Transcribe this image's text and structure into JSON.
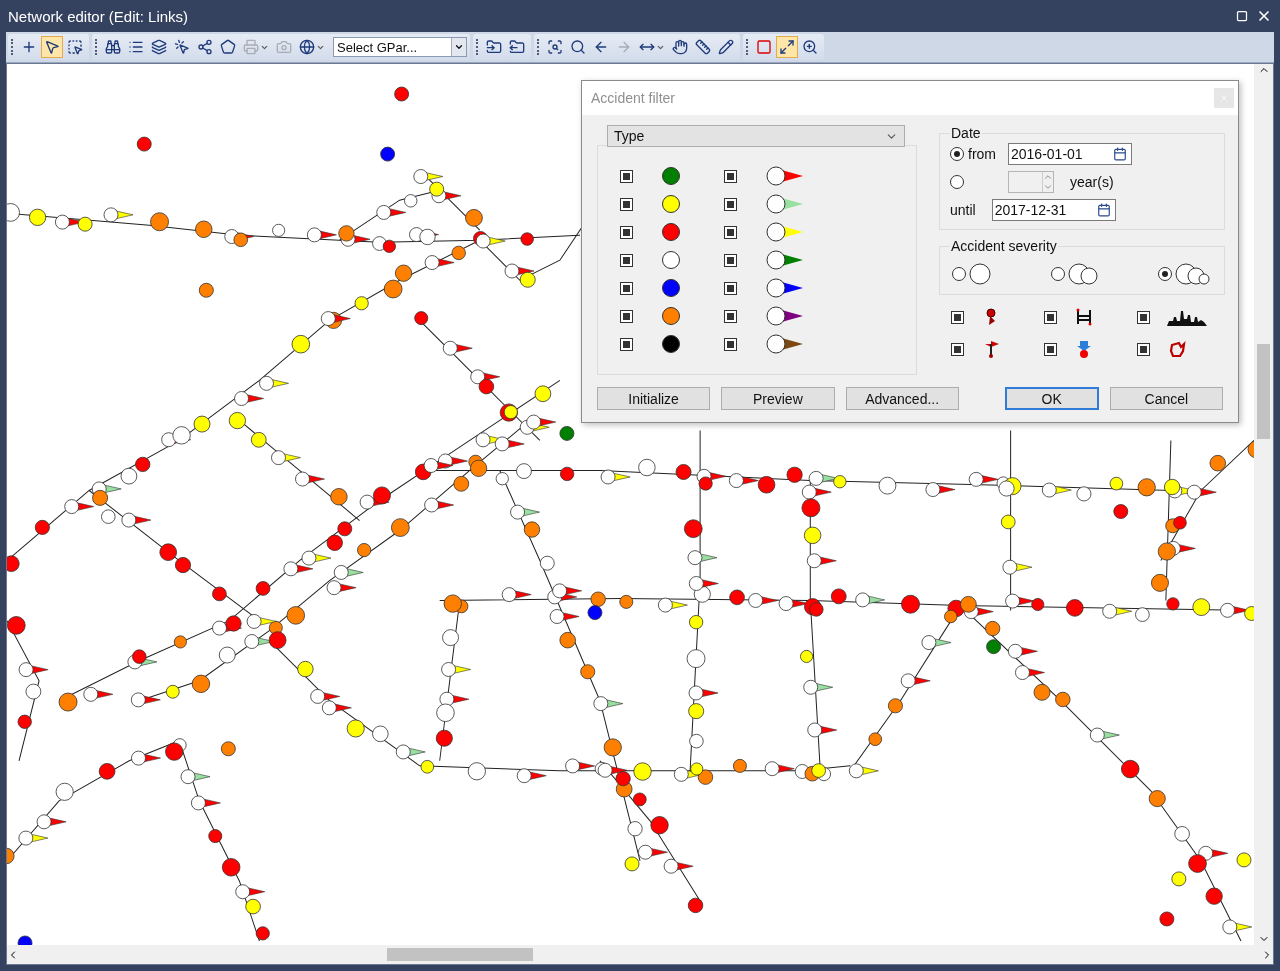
{
  "window": {
    "title": "Network editor (Edit: Links)"
  },
  "toolbar": {
    "groups": [
      [
        {
          "kind": "button",
          "selected": false,
          "disabled": false
        },
        {
          "kind": "button",
          "selected": true,
          "disabled": false
        },
        {
          "kind": "button",
          "selected": false,
          "disabled": false
        }
      ],
      [
        {
          "kind": "button",
          "selected": false,
          "disabled": false
        },
        {
          "kind": "button",
          "selected": false,
          "disabled": false
        },
        {
          "kind": "button",
          "selected": false,
          "disabled": false
        },
        {
          "kind": "button",
          "selected": false,
          "disabled": false
        },
        {
          "kind": "button",
          "selected": false,
          "disabled": false
        },
        {
          "kind": "button",
          "selected": false,
          "disabled": false
        },
        {
          "kind": "split",
          "selected": false,
          "disabled": true
        },
        {
          "kind": "button",
          "selected": false,
          "disabled": true
        },
        {
          "kind": "split",
          "selected": false,
          "disabled": false
        }
      ],
      [
        {
          "kind": "button",
          "selected": false,
          "disabled": false
        },
        {
          "kind": "button",
          "selected": false,
          "disabled": false
        }
      ],
      [
        {
          "kind": "button",
          "selected": false,
          "disabled": false
        },
        {
          "kind": "button",
          "selected": false,
          "disabled": false
        },
        {
          "kind": "button",
          "selected": false,
          "disabled": false
        },
        {
          "kind": "button",
          "selected": false,
          "disabled": true
        },
        {
          "kind": "split",
          "selected": false,
          "disabled": false
        },
        {
          "kind": "button",
          "selected": false,
          "disabled": false
        },
        {
          "kind": "button",
          "selected": false,
          "disabled": false
        },
        {
          "kind": "button",
          "selected": false,
          "disabled": false
        }
      ],
      [
        {
          "kind": "button",
          "selected": false,
          "disabled": false
        },
        {
          "kind": "button",
          "selected": true,
          "disabled": false
        },
        {
          "kind": "button",
          "selected": false,
          "disabled": false
        }
      ]
    ],
    "layer_select": {
      "value": "Select GPar..."
    }
  },
  "dialog": {
    "title": "Accident filter",
    "type_select": {
      "value": "Type"
    },
    "circle_types": [
      {
        "checked": true,
        "color": "#007f00"
      },
      {
        "checked": true,
        "color": "#ffff00"
      },
      {
        "checked": true,
        "color": "#ff0000"
      },
      {
        "checked": true,
        "color": "#ffffff"
      },
      {
        "checked": true,
        "color": "#0000ff"
      },
      {
        "checked": true,
        "color": "#ff8000"
      },
      {
        "checked": true,
        "color": "#000000"
      }
    ],
    "flag_types": [
      {
        "checked": true,
        "color": "#ff0000"
      },
      {
        "checked": true,
        "color": "#99e0a0"
      },
      {
        "checked": true,
        "color": "#ffff00"
      },
      {
        "checked": true,
        "color": "#008000"
      },
      {
        "checked": true,
        "color": "#0000ff"
      },
      {
        "checked": true,
        "color": "#800080"
      },
      {
        "checked": true,
        "color": "#7a4a10"
      }
    ],
    "date": {
      "label": "Date",
      "from": {
        "label": "from",
        "selected": true,
        "value": "2016-01-01"
      },
      "years": {
        "label": "year(s)",
        "selected": false
      },
      "until": {
        "label": "until",
        "value": "2017-12-31"
      }
    },
    "severity": {
      "label": "Accident severity",
      "options": [
        {
          "selected": false
        },
        {
          "selected": false
        },
        {
          "selected": true
        }
      ]
    },
    "extra_filters": [
      {
        "checked": true
      },
      {
        "checked": true
      },
      {
        "checked": true
      },
      {
        "checked": true
      },
      {
        "checked": true
      },
      {
        "checked": true
      }
    ],
    "buttons": [
      {
        "label": "Initialize",
        "default": false
      },
      {
        "label": "Preview",
        "default": false
      },
      {
        "label": "Advanced...",
        "default": false
      },
      {
        "label": "OK",
        "default": true
      },
      {
        "label": "Cancel",
        "default": false
      }
    ]
  }
}
